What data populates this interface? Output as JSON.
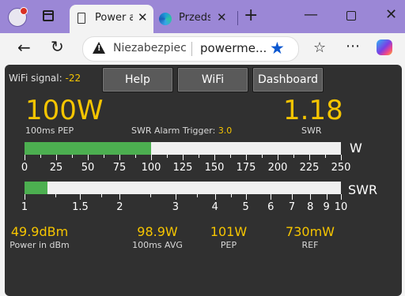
{
  "browser": {
    "tab1_title": "Power a",
    "tab1_close": "✕",
    "tab2_title": "Przedst",
    "tab2_close": "✕",
    "new_tab": "+",
    "minimize": "—",
    "close": "✕",
    "back": "←",
    "reload": "↻",
    "security_label": "Niezabezpiecz",
    "url": "powerme...",
    "star": "★",
    "favorites": "☆",
    "more": "⋯"
  },
  "meter": {
    "wifi_label": "WiFi signal:",
    "wifi_value": "-22",
    "buttons": {
      "help": "Help",
      "wifi": "WiFi",
      "dashboard": "Dashboard"
    },
    "power_value": "100W",
    "power_label": "100ms PEP",
    "alarm_label": "SWR Alarm Trigger:",
    "alarm_value": "3.0",
    "swr_value": "1.18",
    "swr_label": "SWR",
    "power_bar": {
      "unit": "W",
      "fill_fraction": 0.4,
      "ticks": [
        "0",
        "25",
        "50",
        "75",
        "100",
        "125",
        "150",
        "175",
        "200",
        "225",
        "250"
      ]
    },
    "swr_bar": {
      "unit": "SWR",
      "fill_fraction": 0.072,
      "ticks": [
        "1",
        "1.5",
        "2",
        "3",
        "4",
        "5",
        "6",
        "7",
        "8",
        "9",
        "10"
      ]
    },
    "measurements": [
      {
        "value": "49.9dBm",
        "label": "Power in dBm"
      },
      {
        "value": "98.9W",
        "label": "100ms AVG"
      },
      {
        "value": "101W",
        "label": "PEP"
      },
      {
        "value": "730mW",
        "label": "REF"
      }
    ]
  }
}
